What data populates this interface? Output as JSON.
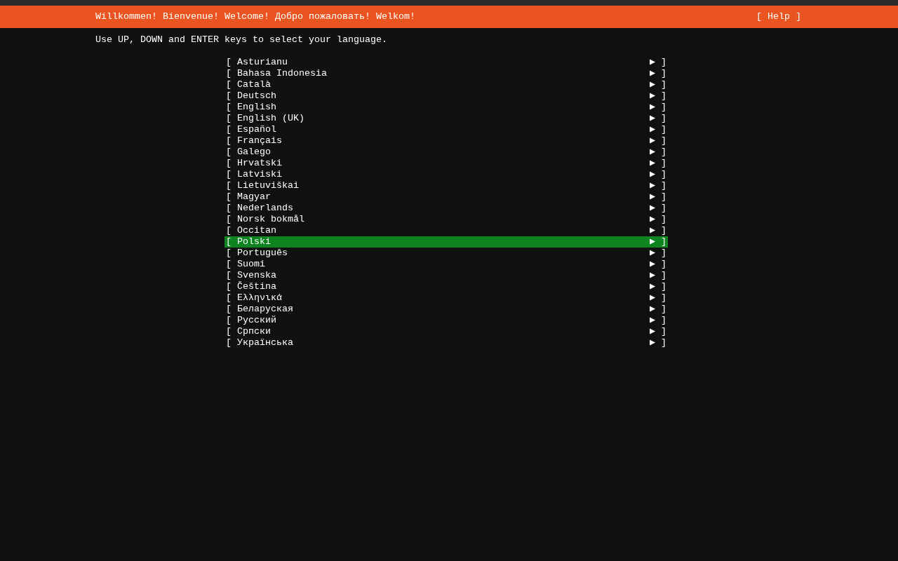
{
  "header": {
    "title": "Willkommen! Bienvenue! Welcome! Добро пожаловать! Welkom!",
    "help": "[ Help ]"
  },
  "instruction": "Use UP, DOWN and ENTER keys to select your language.",
  "languages": [
    {
      "left": "[",
      "label": "Asturianu",
      "right": "▶ ]",
      "selected": false
    },
    {
      "left": "[",
      "label": "Bahasa Indonesia",
      "right": "▶ ]",
      "selected": false
    },
    {
      "left": "[",
      "label": "Català",
      "right": "▶ ]",
      "selected": false
    },
    {
      "left": "[",
      "label": "Deutsch",
      "right": "▶ ]",
      "selected": false
    },
    {
      "left": "[",
      "label": "English",
      "right": "▶ ]",
      "selected": false
    },
    {
      "left": "[",
      "label": "English (UK)",
      "right": "▶ ]",
      "selected": false
    },
    {
      "left": "[",
      "label": "Español",
      "right": "▶ ]",
      "selected": false
    },
    {
      "left": "[",
      "label": "Français",
      "right": "▶ ]",
      "selected": false
    },
    {
      "left": "[",
      "label": "Galego",
      "right": "▶ ]",
      "selected": false
    },
    {
      "left": "[",
      "label": "Hrvatski",
      "right": "▶ ]",
      "selected": false
    },
    {
      "left": "[",
      "label": "Latviski",
      "right": "▶ ]",
      "selected": false
    },
    {
      "left": "[",
      "label": "Lietuviškai",
      "right": "▶ ]",
      "selected": false
    },
    {
      "left": "[",
      "label": "Magyar",
      "right": "▶ ]",
      "selected": false
    },
    {
      "left": "[",
      "label": "Nederlands",
      "right": "▶ ]",
      "selected": false
    },
    {
      "left": "[",
      "label": "Norsk bokmål",
      "right": "▶ ]",
      "selected": false
    },
    {
      "left": "[",
      "label": "Occitan",
      "right": "▶ ]",
      "selected": false
    },
    {
      "left": "[",
      "label": "Polski",
      "right": "▶ ]",
      "selected": true
    },
    {
      "left": "[",
      "label": "Português",
      "right": "▶ ]",
      "selected": false
    },
    {
      "left": "[",
      "label": "Suomi",
      "right": "▶ ]",
      "selected": false
    },
    {
      "left": "[",
      "label": "Svenska",
      "right": "▶ ]",
      "selected": false
    },
    {
      "left": "[",
      "label": "Čeština",
      "right": "▶ ]",
      "selected": false
    },
    {
      "left": "[",
      "label": "Ελληνικά",
      "right": "▶ ]",
      "selected": false
    },
    {
      "left": "[",
      "label": "Беларуская",
      "right": "▶ ]",
      "selected": false
    },
    {
      "left": "[",
      "label": "Русский",
      "right": "▶ ]",
      "selected": false
    },
    {
      "left": "[",
      "label": "Српски",
      "right": "▶ ]",
      "selected": false
    },
    {
      "left": "[",
      "label": "Українська",
      "right": "▶ ]",
      "selected": false
    }
  ]
}
